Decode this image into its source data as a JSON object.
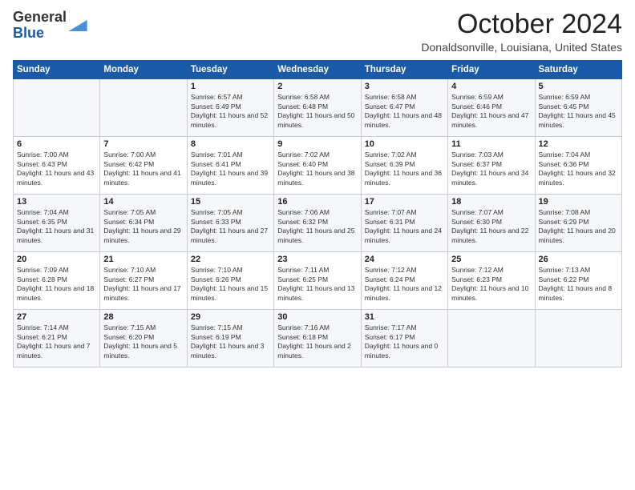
{
  "logo": {
    "general": "General",
    "blue": "Blue"
  },
  "title": "October 2024",
  "location": "Donaldsonville, Louisiana, United States",
  "headers": [
    "Sunday",
    "Monday",
    "Tuesday",
    "Wednesday",
    "Thursday",
    "Friday",
    "Saturday"
  ],
  "weeks": [
    [
      {
        "day": "",
        "sunrise": "",
        "sunset": "",
        "daylight": ""
      },
      {
        "day": "",
        "sunrise": "",
        "sunset": "",
        "daylight": ""
      },
      {
        "day": "1",
        "sunrise": "Sunrise: 6:57 AM",
        "sunset": "Sunset: 6:49 PM",
        "daylight": "Daylight: 11 hours and 52 minutes."
      },
      {
        "day": "2",
        "sunrise": "Sunrise: 6:58 AM",
        "sunset": "Sunset: 6:48 PM",
        "daylight": "Daylight: 11 hours and 50 minutes."
      },
      {
        "day": "3",
        "sunrise": "Sunrise: 6:58 AM",
        "sunset": "Sunset: 6:47 PM",
        "daylight": "Daylight: 11 hours and 48 minutes."
      },
      {
        "day": "4",
        "sunrise": "Sunrise: 6:59 AM",
        "sunset": "Sunset: 6:46 PM",
        "daylight": "Daylight: 11 hours and 47 minutes."
      },
      {
        "day": "5",
        "sunrise": "Sunrise: 6:59 AM",
        "sunset": "Sunset: 6:45 PM",
        "daylight": "Daylight: 11 hours and 45 minutes."
      }
    ],
    [
      {
        "day": "6",
        "sunrise": "Sunrise: 7:00 AM",
        "sunset": "Sunset: 6:43 PM",
        "daylight": "Daylight: 11 hours and 43 minutes."
      },
      {
        "day": "7",
        "sunrise": "Sunrise: 7:00 AM",
        "sunset": "Sunset: 6:42 PM",
        "daylight": "Daylight: 11 hours and 41 minutes."
      },
      {
        "day": "8",
        "sunrise": "Sunrise: 7:01 AM",
        "sunset": "Sunset: 6:41 PM",
        "daylight": "Daylight: 11 hours and 39 minutes."
      },
      {
        "day": "9",
        "sunrise": "Sunrise: 7:02 AM",
        "sunset": "Sunset: 6:40 PM",
        "daylight": "Daylight: 11 hours and 38 minutes."
      },
      {
        "day": "10",
        "sunrise": "Sunrise: 7:02 AM",
        "sunset": "Sunset: 6:39 PM",
        "daylight": "Daylight: 11 hours and 36 minutes."
      },
      {
        "day": "11",
        "sunrise": "Sunrise: 7:03 AM",
        "sunset": "Sunset: 6:37 PM",
        "daylight": "Daylight: 11 hours and 34 minutes."
      },
      {
        "day": "12",
        "sunrise": "Sunrise: 7:04 AM",
        "sunset": "Sunset: 6:36 PM",
        "daylight": "Daylight: 11 hours and 32 minutes."
      }
    ],
    [
      {
        "day": "13",
        "sunrise": "Sunrise: 7:04 AM",
        "sunset": "Sunset: 6:35 PM",
        "daylight": "Daylight: 11 hours and 31 minutes."
      },
      {
        "day": "14",
        "sunrise": "Sunrise: 7:05 AM",
        "sunset": "Sunset: 6:34 PM",
        "daylight": "Daylight: 11 hours and 29 minutes."
      },
      {
        "day": "15",
        "sunrise": "Sunrise: 7:05 AM",
        "sunset": "Sunset: 6:33 PM",
        "daylight": "Daylight: 11 hours and 27 minutes."
      },
      {
        "day": "16",
        "sunrise": "Sunrise: 7:06 AM",
        "sunset": "Sunset: 6:32 PM",
        "daylight": "Daylight: 11 hours and 25 minutes."
      },
      {
        "day": "17",
        "sunrise": "Sunrise: 7:07 AM",
        "sunset": "Sunset: 6:31 PM",
        "daylight": "Daylight: 11 hours and 24 minutes."
      },
      {
        "day": "18",
        "sunrise": "Sunrise: 7:07 AM",
        "sunset": "Sunset: 6:30 PM",
        "daylight": "Daylight: 11 hours and 22 minutes."
      },
      {
        "day": "19",
        "sunrise": "Sunrise: 7:08 AM",
        "sunset": "Sunset: 6:29 PM",
        "daylight": "Daylight: 11 hours and 20 minutes."
      }
    ],
    [
      {
        "day": "20",
        "sunrise": "Sunrise: 7:09 AM",
        "sunset": "Sunset: 6:28 PM",
        "daylight": "Daylight: 11 hours and 18 minutes."
      },
      {
        "day": "21",
        "sunrise": "Sunrise: 7:10 AM",
        "sunset": "Sunset: 6:27 PM",
        "daylight": "Daylight: 11 hours and 17 minutes."
      },
      {
        "day": "22",
        "sunrise": "Sunrise: 7:10 AM",
        "sunset": "Sunset: 6:26 PM",
        "daylight": "Daylight: 11 hours and 15 minutes."
      },
      {
        "day": "23",
        "sunrise": "Sunrise: 7:11 AM",
        "sunset": "Sunset: 6:25 PM",
        "daylight": "Daylight: 11 hours and 13 minutes."
      },
      {
        "day": "24",
        "sunrise": "Sunrise: 7:12 AM",
        "sunset": "Sunset: 6:24 PM",
        "daylight": "Daylight: 11 hours and 12 minutes."
      },
      {
        "day": "25",
        "sunrise": "Sunrise: 7:12 AM",
        "sunset": "Sunset: 6:23 PM",
        "daylight": "Daylight: 11 hours and 10 minutes."
      },
      {
        "day": "26",
        "sunrise": "Sunrise: 7:13 AM",
        "sunset": "Sunset: 6:22 PM",
        "daylight": "Daylight: 11 hours and 8 minutes."
      }
    ],
    [
      {
        "day": "27",
        "sunrise": "Sunrise: 7:14 AM",
        "sunset": "Sunset: 6:21 PM",
        "daylight": "Daylight: 11 hours and 7 minutes."
      },
      {
        "day": "28",
        "sunrise": "Sunrise: 7:15 AM",
        "sunset": "Sunset: 6:20 PM",
        "daylight": "Daylight: 11 hours and 5 minutes."
      },
      {
        "day": "29",
        "sunrise": "Sunrise: 7:15 AM",
        "sunset": "Sunset: 6:19 PM",
        "daylight": "Daylight: 11 hours and 3 minutes."
      },
      {
        "day": "30",
        "sunrise": "Sunrise: 7:16 AM",
        "sunset": "Sunset: 6:18 PM",
        "daylight": "Daylight: 11 hours and 2 minutes."
      },
      {
        "day": "31",
        "sunrise": "Sunrise: 7:17 AM",
        "sunset": "Sunset: 6:17 PM",
        "daylight": "Daylight: 11 hours and 0 minutes."
      },
      {
        "day": "",
        "sunrise": "",
        "sunset": "",
        "daylight": ""
      },
      {
        "day": "",
        "sunrise": "",
        "sunset": "",
        "daylight": ""
      }
    ]
  ]
}
